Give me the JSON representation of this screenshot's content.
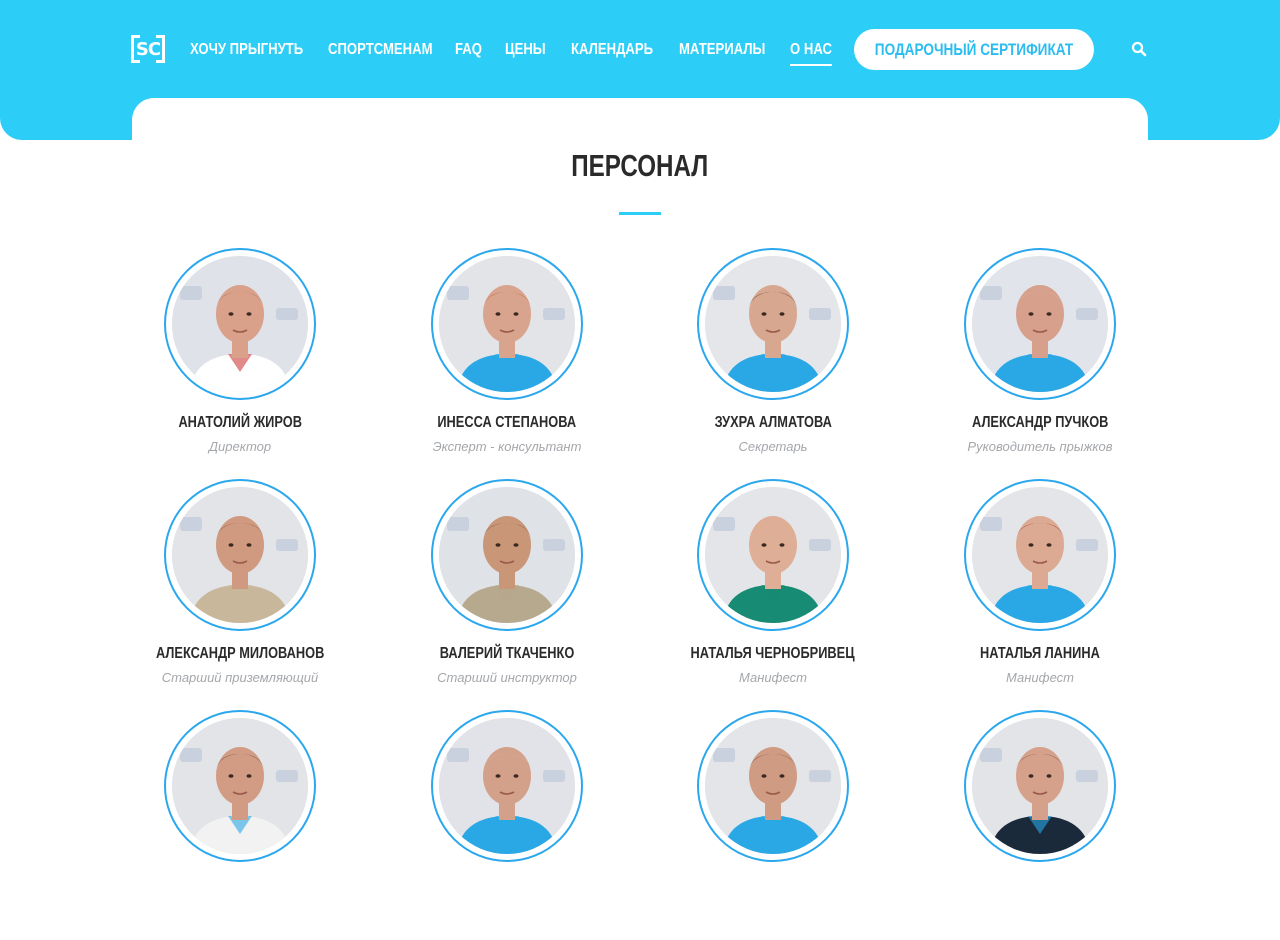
{
  "header": {
    "logo_text": "SC",
    "nav": [
      {
        "label": "ХОЧУ ПРЫГНУТЬ",
        "active": false
      },
      {
        "label": "СПОРТСМЕНАМ",
        "active": false
      },
      {
        "label": "FAQ",
        "active": false
      },
      {
        "label": "ЦЕНЫ",
        "active": false
      },
      {
        "label": "КАЛЕНДАРЬ",
        "active": false
      },
      {
        "label": "МАТЕРИАЛЫ",
        "active": false
      },
      {
        "label": "О НАС",
        "active": true
      }
    ],
    "cta_label": "ПОДАРОЧНЫЙ СЕРТИФИКАТ",
    "search_icon": "search-icon"
  },
  "colors": {
    "brand": "#2ccdf7",
    "avatar_ring": "#2ba7ee",
    "name_text": "#2b2b2b",
    "role_text": "#a4a7ab"
  },
  "main": {
    "title": "ПЕРСОНАЛ",
    "staff": [
      {
        "name": "АНАТОЛИЙ ЖИРОВ",
        "role": "Директор"
      },
      {
        "name": "ИНЕССА СТЕПАНОВА",
        "role": "Эксперт - консультант"
      },
      {
        "name": "ЗУХРА АЛМАТОВА",
        "role": "Секретарь"
      },
      {
        "name": "АЛЕКСАНДР ПУЧКОВ",
        "role": "Руководитель прыжков"
      },
      {
        "name": "АЛЕКСАНДР МИЛОВАНОВ",
        "role": "Старший приземляющий"
      },
      {
        "name": "ВАЛЕРИЙ ТКАЧЕНКО",
        "role": "Старший инструктор"
      },
      {
        "name": "НАТАЛЬЯ ЧЕРНОБРИВЕЦ",
        "role": "Манифест"
      },
      {
        "name": "НАТАЛЬЯ ЛАНИНА",
        "role": "Манифест"
      },
      {
        "name": "",
        "role": ""
      },
      {
        "name": "",
        "role": ""
      },
      {
        "name": "",
        "role": ""
      },
      {
        "name": "",
        "role": ""
      }
    ]
  }
}
